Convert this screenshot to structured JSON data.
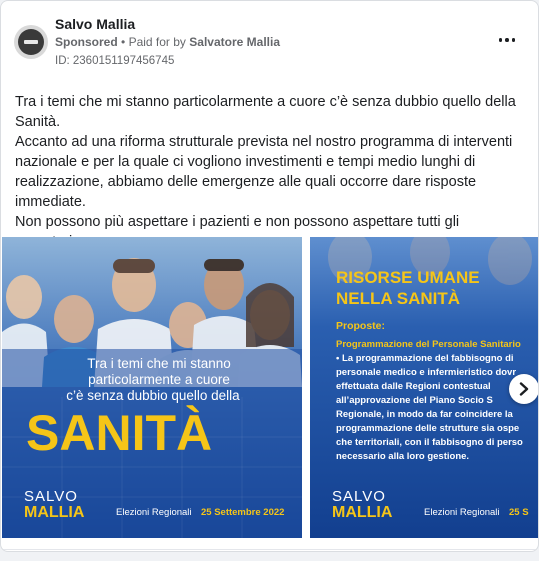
{
  "post": {
    "page_name": "Salvo Mallia",
    "sponsored_label": "Sponsored",
    "paid_for_prefix": "Paid for by",
    "paid_for_by": "Salvatore Mallia",
    "ad_id": "ID: 236015119745674­5",
    "more_icon": "more-horizontal-icon",
    "avatar_icon": "blocked-avatar-icon"
  },
  "body": {
    "lines": [
      "Tra i temi che mi stanno particolarmente a cuore c’è senza dubbio quello della Sanità.",
      "Accanto ad una riforma strutturale prevista nel nostro programma di interventi nazionale e per la quale ci vogliono investimenti e tempi medio lunghi di realizzazione, abbiamo delle emergenze alle quali occorre dare risposte immediate.",
      "Non possono più aspettare i pazienti e non possono aspettare tutti gli operatori…"
    ]
  },
  "slide1": {
    "headline_line1": "Tra i temi che mi stanno",
    "headline_line2": "particolarmente a cuore",
    "headline_line3": "c’è senza dubbio quello della",
    "big_word": "SANITÀ",
    "logo_top": "SALVO",
    "logo_bottom": "MALLIA",
    "election_text": "Elezioni Regionali",
    "election_date": "25 Settembre 2022"
  },
  "slide2": {
    "title_line1": "RISORSE UMANE",
    "title_line2": "NELLA SANITÀ",
    "proposte": "Proposte:",
    "subheading": "Programmazione del Personale Sanitario",
    "bullet_lines": [
      "• La programmazione del fabbisogno di",
      "personale medico e infermieristico dovr",
      "effettuata dalle Regioni contestual",
      "all’approvazione del Piano Socio S",
      "Regionale, in modo da far coincidere la",
      "programmazione delle strutture sia ospe",
      "che territoriali, con il fabbisogno di perso",
      "necessario alla loro gestione."
    ],
    "logo_top": "SALVO",
    "logo_bottom": "MALLIA",
    "election_text": "Elezioni Regionali",
    "election_date": "25 S"
  },
  "colors": {
    "accent_yellow": "#f5c518",
    "slide_blue": "#1f4fa3",
    "slide_blue_dark": "#0f3a88",
    "text_gray": "#65676b"
  }
}
